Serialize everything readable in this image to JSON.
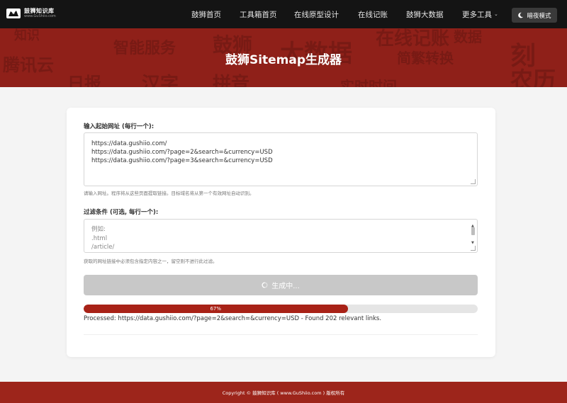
{
  "header": {
    "logo_title": "鼓狮知识库",
    "logo_sub": "www.GuShiio.com",
    "nav": [
      "鼓狮首页",
      "工具箱首页",
      "在线原型设计",
      "在线记账",
      "鼓狮大数据",
      "更多工具"
    ],
    "night_mode_label": "暗夜模式"
  },
  "hero": {
    "title": "鼓狮Sitemap生成器",
    "bg_words": [
      "智能服务",
      "鼓狮",
      "大数据",
      "在线记账",
      "刻",
      "腾讯云",
      "简繁转换",
      "日报",
      "汉字",
      "拼音",
      "实时时间",
      "农历",
      "知识",
      "数据"
    ]
  },
  "form": {
    "urls_label": "输入起始网址 (每行一个):",
    "urls_lines": [
      "https://data.gushiio.com/",
      "https://data.gushiio.com/?page=2&search=&currency=USD",
      "https://data.gushiio.com/?page=3&search=&currency=USD"
    ],
    "urls_hint": "请输入网址。程序将从这些页面提取链接。目标域名将从第一个有效网址自动识别。",
    "filter_label": "过滤条件 (可选, 每行一个):",
    "filter_placeholder_lines": [
      "例如:",
      ".html",
      "/article/"
    ],
    "filter_hint": "获取的网址链接中必须包含指定内容之一，留空则不进行此过滤。",
    "generate_label": "生成中..."
  },
  "progress": {
    "percent": 67,
    "percent_label": "67%",
    "status": "Processed: https://data.gushiio.com/?page=2&search=&currency=USD - Found 202 relevant links."
  },
  "footer": {
    "text": "Copyright © 鼓狮知识库 ( www.GuShiio.com ) 版权所有"
  },
  "colors": {
    "accent": "#a82217",
    "hero_bg": "#8f2019",
    "navbar_bg": "#141414",
    "button_disabled": "#c8c8c8"
  }
}
